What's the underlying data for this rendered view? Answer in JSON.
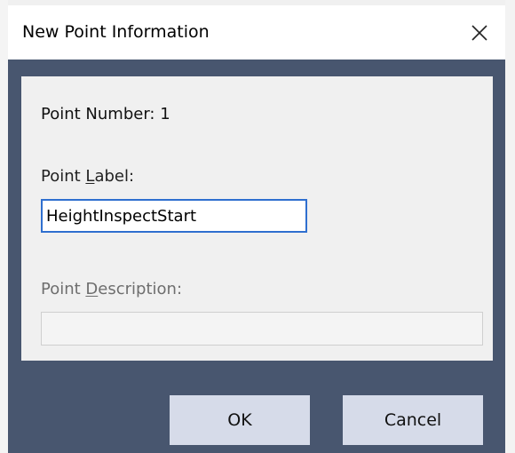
{
  "dialog": {
    "title": "New Point Information",
    "close_icon": "close-icon"
  },
  "point_number": {
    "label": "Point Number: 1"
  },
  "point_label": {
    "label_pre": "Point ",
    "label_accel": "L",
    "label_post": "abel:",
    "value": "HeightInspectStart"
  },
  "point_description": {
    "label_pre": "Point ",
    "label_accel": "D",
    "label_post": "escription:",
    "value": ""
  },
  "buttons": {
    "ok": "OK",
    "cancel": "Cancel"
  },
  "colors": {
    "dialog_frame": "#48566f",
    "panel": "#f0f0f0",
    "button": "#d6dbe9",
    "focus_border": "#2f6fcf"
  }
}
